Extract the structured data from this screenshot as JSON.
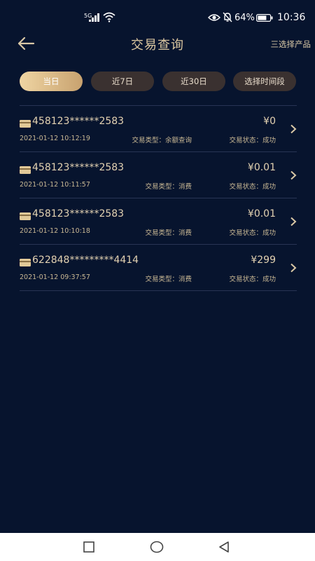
{
  "status_bar": {
    "network": "5G",
    "battery": "64%",
    "time": "10:36",
    "icons": [
      "signal-icon",
      "wifi-icon",
      "eye-icon",
      "mute-icon",
      "battery-icon"
    ]
  },
  "header": {
    "title": "交易查询",
    "select_product": "三选择产品",
    "back_icon": "arrow-left-icon"
  },
  "filters": [
    {
      "label": "当日",
      "active": true
    },
    {
      "label": "近7日",
      "active": false
    },
    {
      "label": "近30日",
      "active": false
    },
    {
      "label": "选择时间段",
      "active": false
    }
  ],
  "transactions": [
    {
      "card": "458123******2583",
      "amount": "¥0",
      "datetime": "2021-01-12 10:12:19",
      "type": "交易类型：余额查询",
      "status": "交易状态：成功"
    },
    {
      "card": "458123******2583",
      "amount": "¥0.01",
      "datetime": "2021-01-12 10:11:57",
      "type": "交易类型：消费",
      "status": "交易状态：成功"
    },
    {
      "card": "458123******2583",
      "amount": "¥0.01",
      "datetime": "2021-01-12 10:10:18",
      "type": "交易类型：消费",
      "status": "交易状态：成功"
    },
    {
      "card": "622848*********4414",
      "amount": "¥299",
      "datetime": "2021-01-12 09:37:57",
      "type": "交易类型：消费",
      "status": "交易状态：成功"
    }
  ],
  "colors": {
    "background": "#07142e",
    "gold": "#d9c8a6",
    "active_filter": "#e6c58f",
    "inactive_filter": "#3a3130"
  }
}
